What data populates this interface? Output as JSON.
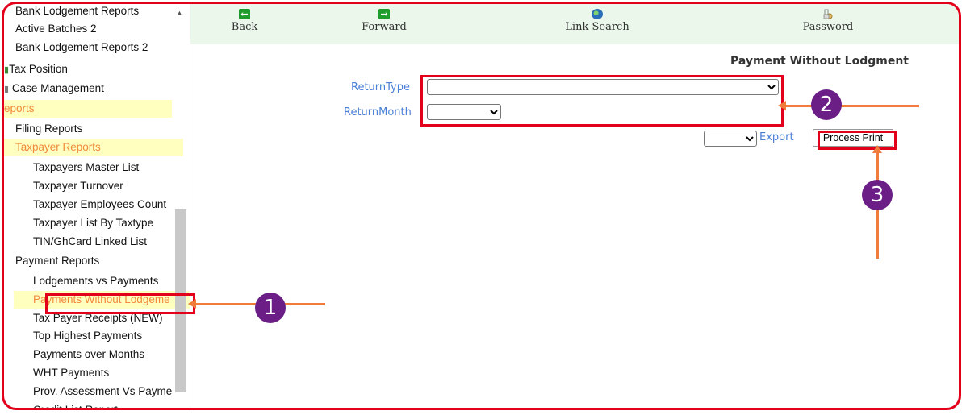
{
  "sidebar": {
    "items": [
      {
        "label": "Bank Lodgement Reports"
      },
      {
        "label": "Active Batches 2"
      },
      {
        "label": "Bank Lodgement Reports 2"
      },
      {
        "label": "Tax Position"
      },
      {
        "label": "Case Management"
      },
      {
        "label": "eports"
      },
      {
        "label": "Filing Reports"
      },
      {
        "label": "Taxpayer Reports"
      },
      {
        "label": "Taxpayers Master List"
      },
      {
        "label": "Taxpayer Turnover"
      },
      {
        "label": "Taxpayer Employees Count"
      },
      {
        "label": "Taxpayer List By Taxtype"
      },
      {
        "label": "TIN/GhCard Linked List"
      },
      {
        "label": "Payment Reports"
      },
      {
        "label": "Lodgements vs Payments"
      },
      {
        "label": "Payments Without Lodgeme"
      },
      {
        "label": "Tax Payer Receipts (NEW)"
      },
      {
        "label": "Top Highest Payments"
      },
      {
        "label": "Payments over Months"
      },
      {
        "label": "WHT Payments"
      },
      {
        "label": "Prov. Assessment Vs Payme"
      },
      {
        "label": "Credit List Report"
      }
    ]
  },
  "toolbar": {
    "back": "Back",
    "forward": "Forward",
    "link_search": "Link Search",
    "password": "Password"
  },
  "main": {
    "title": "Payment Without Lodgment",
    "return_type_label": "ReturnType",
    "return_month_label": "ReturnMonth",
    "return_type_value": "",
    "return_month_value": "",
    "export_format_value": "",
    "export_label": "Export",
    "process_print_label": "Process Print"
  },
  "annotations": {
    "step1": "1",
    "step2": "2",
    "step3": "3"
  },
  "colors": {
    "highlight_box": "#e3001b",
    "arrow": "#f07b3a",
    "badge": "#6b1f86",
    "toolbar_bg": "#eaf7ea",
    "selected_row_bg": "#ffffc0",
    "label_blue": "#4a7fd6"
  }
}
